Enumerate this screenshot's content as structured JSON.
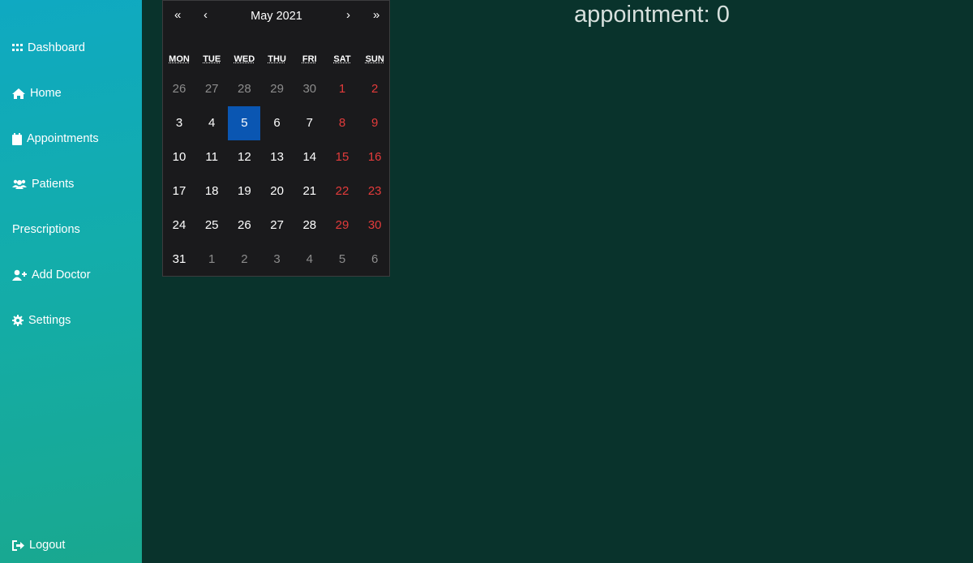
{
  "sidebar": {
    "items": [
      {
        "key": "dashboard",
        "label": "Dashboard",
        "icon": "grid-icon"
      },
      {
        "key": "home",
        "label": "Home",
        "icon": "home-icon"
      },
      {
        "key": "appointments",
        "label": "Appointments",
        "icon": "calendar-icon"
      },
      {
        "key": "patients",
        "label": "Patients",
        "icon": "users-icon"
      },
      {
        "key": "prescriptions",
        "label": "Prescriptions",
        "icon": ""
      },
      {
        "key": "add-doctor",
        "label": "Add Doctor",
        "icon": "user-plus-icon"
      },
      {
        "key": "settings",
        "label": "Settings",
        "icon": "gear-icon"
      }
    ],
    "logout": {
      "label": "Logout",
      "icon": "sign-out-icon"
    }
  },
  "calendar": {
    "nav": {
      "prev_year": "«",
      "prev_month": "‹",
      "next_month": "›",
      "next_year": "»"
    },
    "month_label": "May 2021",
    "weekdays": [
      "MON",
      "TUE",
      "WED",
      "THU",
      "FRI",
      "SAT",
      "SUN"
    ],
    "weeks": [
      [
        "26",
        "27",
        "28",
        "29",
        "30",
        "1",
        "2"
      ],
      [
        "3",
        "4",
        "5",
        "6",
        "7",
        "8",
        "9"
      ],
      [
        "10",
        "11",
        "12",
        "13",
        "14",
        "15",
        "16"
      ],
      [
        "17",
        "18",
        "19",
        "20",
        "21",
        "22",
        "23"
      ],
      [
        "24",
        "25",
        "26",
        "27",
        "28",
        "29",
        "30"
      ],
      [
        "31",
        "1",
        "2",
        "3",
        "4",
        "5",
        "6"
      ]
    ],
    "selected": "5",
    "colors": {
      "weekend": "#e33b3b",
      "selected": "#0a56b2",
      "other_month": "#8c8c8c"
    }
  },
  "appointment_count": "appointment: 0"
}
